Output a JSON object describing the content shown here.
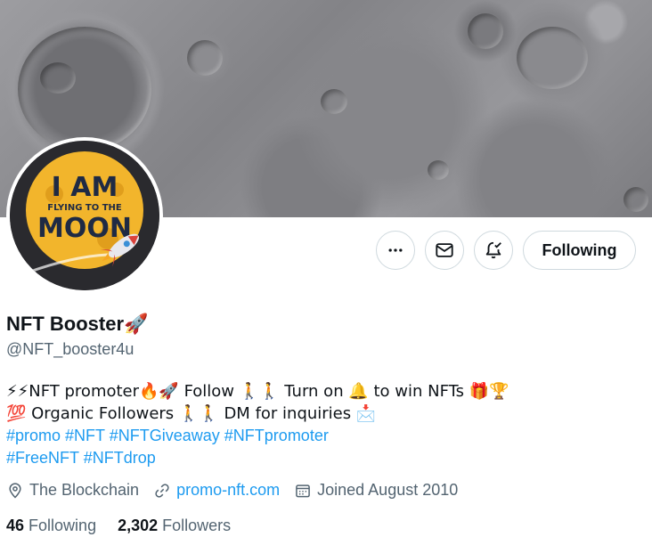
{
  "profile": {
    "name": "NFT Booster",
    "name_emoji": "🚀",
    "handle": "@NFT_booster4u",
    "avatar_text": [
      "I AM",
      "FLYING TO THE",
      "MOON"
    ]
  },
  "actions": {
    "more_icon": "more-horizontal-icon",
    "message_icon": "envelope-icon",
    "notify_icon": "bell-check-icon",
    "following_label": "Following"
  },
  "bio": {
    "line1": "⚡⚡NFT promoter🔥🚀 Follow 🚶🚶 Turn on 🔔 to win NFTs 🎁🏆",
    "line2": "💯 Organic Followers 🚶🚶 DM for inquiries 📩",
    "line3_tags": [
      "#promo",
      "#NFT",
      "#NFTGiveaway",
      "#NFTpromoter"
    ],
    "line4_tags": [
      "#FreeNFT",
      "#NFTdrop"
    ]
  },
  "meta": {
    "location": "The Blockchain",
    "website": "promo-nft.com",
    "joined": "Joined August 2010"
  },
  "stats": {
    "following_count": "46",
    "following_label": "Following",
    "followers_count": "2,302",
    "followers_label": "Followers"
  },
  "colors": {
    "accent": "#1d9bf0",
    "text": "#0f1419",
    "secondary": "#536471",
    "border": "#cfd9de"
  }
}
